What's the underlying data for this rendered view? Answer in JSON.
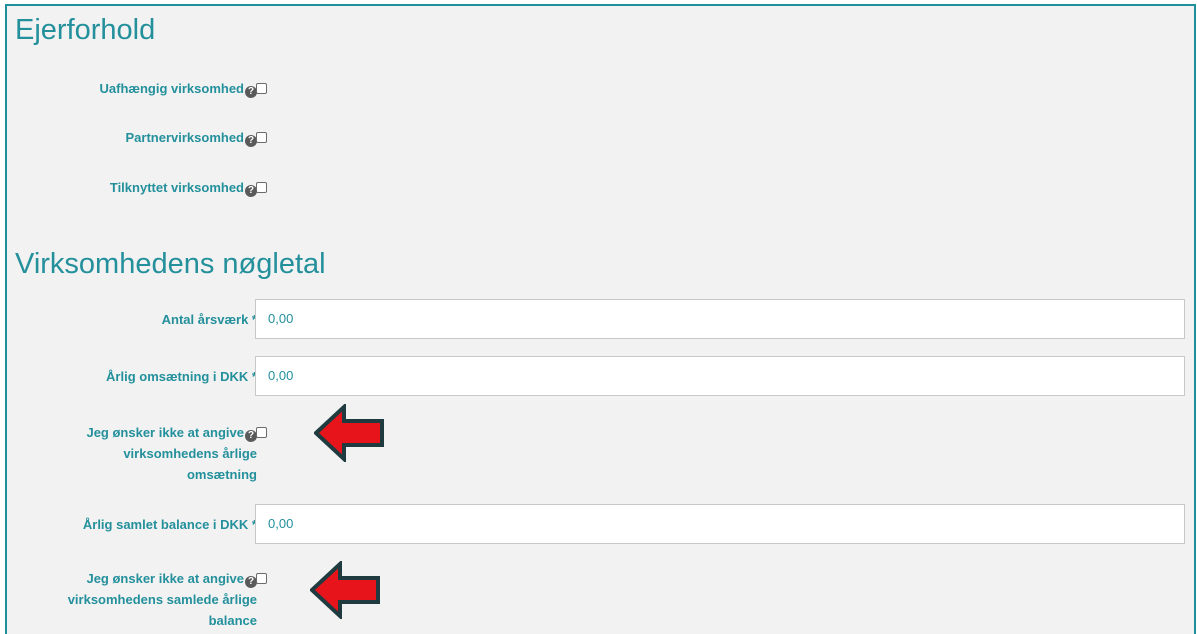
{
  "sections": {
    "ownership": {
      "title": "Ejerforhold",
      "options": [
        {
          "label": "Uafhængig virksomhed",
          "checked": false
        },
        {
          "label": "Partnervirksomhed",
          "checked": false
        },
        {
          "label": "Tilknyttet virksomhed",
          "checked": false
        }
      ]
    },
    "keyfigures": {
      "title": "Virksomhedens nøgletal",
      "employees": {
        "label": "Antal årsværk *",
        "value": "0,00"
      },
      "turnover": {
        "label": "Årlig omsætning i DKK *",
        "value": "0,00"
      },
      "no_turnover": {
        "label_lines": [
          "Jeg ønsker ikke at angive",
          "virksomhedens årlige",
          "omsætning"
        ],
        "checked": false
      },
      "balance": {
        "label": "Årlig samlet balance i DKK *",
        "value": "0,00"
      },
      "no_balance": {
        "label_lines": [
          "Jeg ønsker ikke at angive",
          "virksomhedens samlede årlige",
          "balance"
        ],
        "checked": false
      }
    }
  },
  "icons": {
    "help": "question-circle-icon",
    "help_glyph": "?",
    "annotation": "red-arrow-left-icon"
  },
  "colors": {
    "accent": "#23909c",
    "frame": "#1f8f9b",
    "arrow_fill": "#e8141b",
    "arrow_outline": "#1f3b40",
    "background": "#f2f2f2"
  }
}
